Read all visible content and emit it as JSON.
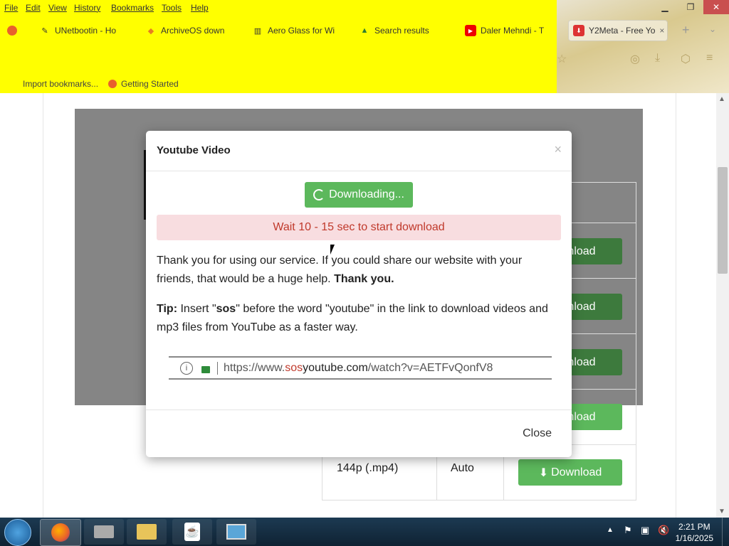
{
  "menu": [
    "File",
    "Edit",
    "View",
    "History",
    "Bookmarks",
    "Tools",
    "Help"
  ],
  "tabs": [
    {
      "label": "UNetbootin - Ho",
      "icon": "pencil-icon"
    },
    {
      "label": "ArchiveOS down",
      "icon": "diamond-icon"
    },
    {
      "label": "Aero Glass for Wi",
      "icon": "columns-icon"
    },
    {
      "label": "Search results",
      "icon": "drive-icon"
    },
    {
      "label": "Daler Mehndi - T",
      "icon": "youtube-icon"
    },
    {
      "label": "Y2Meta - Free Yo",
      "icon": "y2meta-icon"
    }
  ],
  "bookmarks": [
    "Import bookmarks...",
    "Getting Started"
  ],
  "table": {
    "behind_buttons": [
      "Download",
      "Download",
      "Download",
      "Download"
    ],
    "last_row": {
      "quality": "144p (.mp4)",
      "size": "Auto",
      "button": "Download"
    }
  },
  "modal": {
    "title": "Youtube Video",
    "close_x": "×",
    "downloading_label": "Downloading...",
    "alert": "Wait 10 - 15 sec to start download",
    "thanks_text": "Thank you for using our service. If you could share our website with your friends, that would be a huge help.",
    "thanks_bold": "Thank you.",
    "tip_label": "Tip:",
    "tip_pre": "Insert \"",
    "tip_bold": "sos",
    "tip_post": "\" before the word \"youtube\" in the link to download videos and mp3 files from YouTube as a faster way.",
    "url_prefix": "https://www.",
    "url_highlight": "sos",
    "url_domain": "youtube.com",
    "url_path": "/watch?v=AETFvQonfV8",
    "close_label": "Close"
  },
  "taskbar": {
    "time": "2:21 PM",
    "date": "1/16/2025"
  },
  "colors": {
    "accent_green": "#5cb85c",
    "alert_text": "#c0392b",
    "alert_bg": "#f8dde0",
    "chrome_yellow": "#ffff00"
  }
}
